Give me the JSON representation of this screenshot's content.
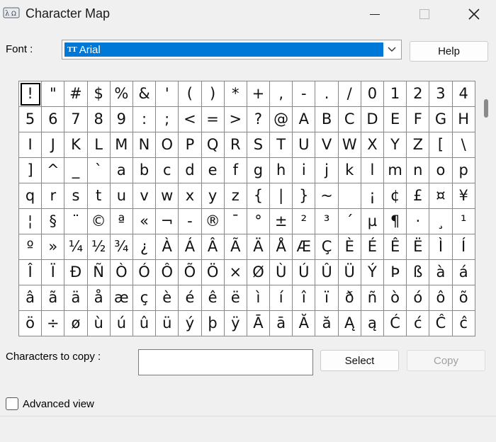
{
  "window": {
    "title": "Character Map",
    "icons": {
      "app": "character-map-app-icon",
      "minimize": "minimize-icon",
      "maximize": "maximize-icon",
      "close": "close-icon"
    }
  },
  "font": {
    "label": "Font :",
    "selected": "Arial",
    "type_icon": "truetype-font-icon",
    "dropdown_icon": "chevron-down-icon",
    "selection_color": "#0078d7"
  },
  "help_button": "Help",
  "characters": [
    "!",
    "\"",
    "#",
    "$",
    "%",
    "&",
    "'",
    "(",
    ")",
    "*",
    "+",
    ",",
    "-",
    ".",
    "/",
    "0",
    "1",
    "2",
    "3",
    "4",
    "5",
    "6",
    "7",
    "8",
    "9",
    ":",
    ";",
    "<",
    "=",
    ">",
    "?",
    "@",
    "A",
    "B",
    "C",
    "D",
    "E",
    "F",
    "G",
    "H",
    "I",
    "J",
    "K",
    "L",
    "M",
    "N",
    "O",
    "P",
    "Q",
    "R",
    "S",
    "T",
    "U",
    "V",
    "W",
    "X",
    "Y",
    "Z",
    "[",
    "\\",
    "]",
    "^",
    "_",
    "`",
    "a",
    "b",
    "c",
    "d",
    "e",
    "f",
    "g",
    "h",
    "i",
    "j",
    "k",
    "l",
    "m",
    "n",
    "o",
    "p",
    "q",
    "r",
    "s",
    "t",
    "u",
    "v",
    "w",
    "x",
    "y",
    "z",
    "{",
    "|",
    "}",
    "~",
    " ",
    "¡",
    "¢",
    "£",
    "¤",
    "¥",
    "¦",
    "§",
    "¨",
    "©",
    "ª",
    "«",
    "¬",
    "-",
    "®",
    "¯",
    "°",
    "±",
    "²",
    "³",
    "´",
    "µ",
    "¶",
    "·",
    "¸",
    "¹",
    "º",
    "»",
    "¼",
    "½",
    "¾",
    "¿",
    "À",
    "Á",
    "Â",
    "Ã",
    "Ä",
    "Å",
    "Æ",
    "Ç",
    "È",
    "É",
    "Ê",
    "Ë",
    "Ì",
    "Í",
    "Î",
    "Ï",
    "Ð",
    "Ñ",
    "Ò",
    "Ó",
    "Ô",
    "Õ",
    "Ö",
    "×",
    "Ø",
    "Ù",
    "Ú",
    "Û",
    "Ü",
    "Ý",
    "Þ",
    "ß",
    "à",
    "á",
    "â",
    "ã",
    "ä",
    "å",
    "æ",
    "ç",
    "è",
    "é",
    "ê",
    "ë",
    "ì",
    "í",
    "î",
    "ï",
    "ð",
    "ñ",
    "ò",
    "ó",
    "ô",
    "õ",
    "ö",
    "÷",
    "ø",
    "ù",
    "ú",
    "û",
    "ü",
    "ý",
    "þ",
    "ÿ",
    "Ā",
    "ā",
    "Ă",
    "ă",
    "Ą",
    "ą",
    "Ć",
    "ć",
    "Ĉ",
    "ĉ"
  ],
  "selected_character": "!",
  "copy": {
    "label": "Characters to copy :",
    "value": "",
    "select_button": "Select",
    "copy_button": "Copy"
  },
  "advanced_view": {
    "label": "Advanced view",
    "checked": false
  }
}
